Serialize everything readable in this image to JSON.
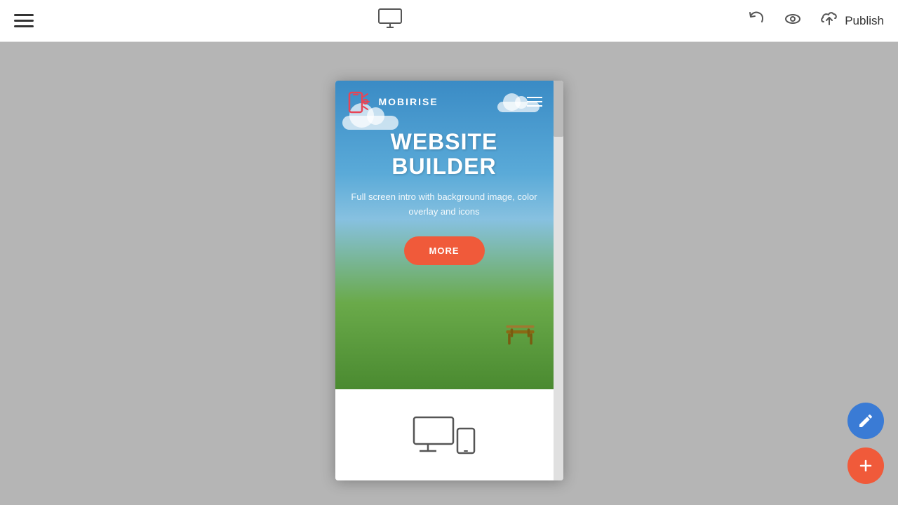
{
  "toolbar": {
    "menu_label": "Menu",
    "undo_label": "Undo",
    "preview_label": "Preview",
    "publish_label": "Publish"
  },
  "preview": {
    "nav": {
      "logo_text": "MOBIRISE",
      "menu_label": "Menu"
    },
    "hero": {
      "title_line1": "WEBSITE",
      "title_line2": "BUILDER",
      "subtitle": "Full screen intro with background image, color overlay and icons",
      "button_label": "MORE"
    }
  },
  "fab": {
    "edit_label": "Edit",
    "add_label": "Add"
  }
}
